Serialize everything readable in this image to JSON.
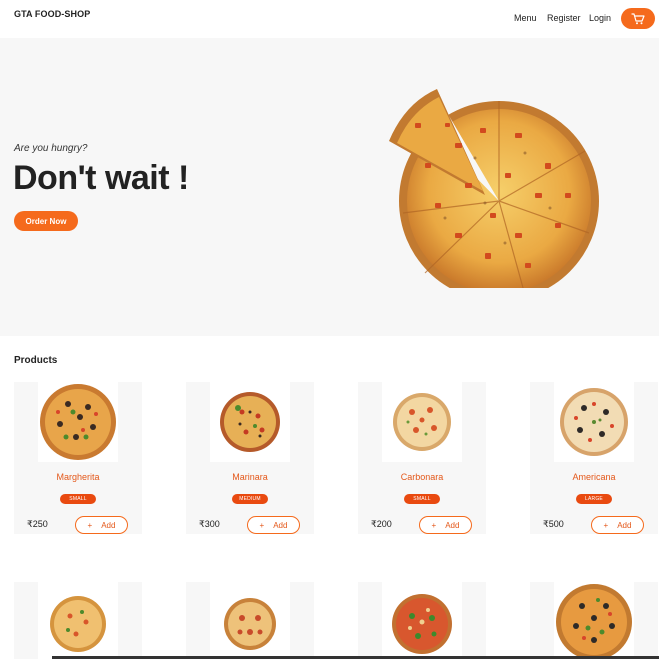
{
  "header": {
    "logo": "GTA FOOD-SHOP",
    "nav": {
      "menu": "Menu",
      "register": "Register",
      "login": "Login"
    },
    "cart_icon": "shopping-cart-icon"
  },
  "hero": {
    "subtitle": "Are you hungry?",
    "title": "Don't wait !",
    "cta": "Order Now"
  },
  "products": {
    "title": "Products",
    "add_label": "Add",
    "items": [
      {
        "name": "Margherita",
        "size": "SMALL",
        "price": "₹250"
      },
      {
        "name": "Marinara",
        "size": "MEDIUM",
        "price": "₹300"
      },
      {
        "name": "Carbonara",
        "size": "SMALL",
        "price": "₹200"
      },
      {
        "name": "Americana",
        "size": "LARGE",
        "price": "₹500"
      }
    ]
  },
  "colors": {
    "accent": "#f56a1c",
    "badge": "#e94a10",
    "name": "#e4581a"
  }
}
